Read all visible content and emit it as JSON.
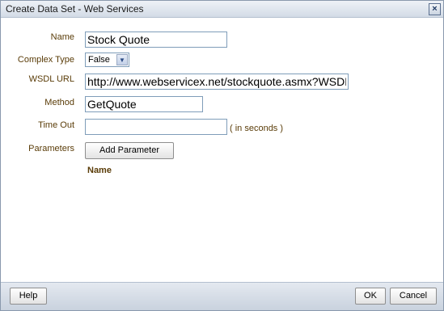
{
  "window": {
    "title": "Create Data Set - Web Services",
    "close_glyph": "×"
  },
  "form": {
    "name": {
      "label": "Name",
      "value": "Stock Quote"
    },
    "complex_type": {
      "label": "Complex Type",
      "value": "False"
    },
    "wsdl_url": {
      "label": "WSDL URL",
      "value": "http://www.webservicex.net/stockquote.asmx?WSDL"
    },
    "method": {
      "label": "Method",
      "value": "GetQuote"
    },
    "timeout": {
      "label": "Time Out",
      "value": "",
      "hint": "( in seconds )"
    },
    "parameters": {
      "label": "Parameters",
      "add_button": "Add Parameter",
      "column_header": "Name"
    }
  },
  "footer": {
    "help": "Help",
    "ok": "OK",
    "cancel": "Cancel"
  }
}
